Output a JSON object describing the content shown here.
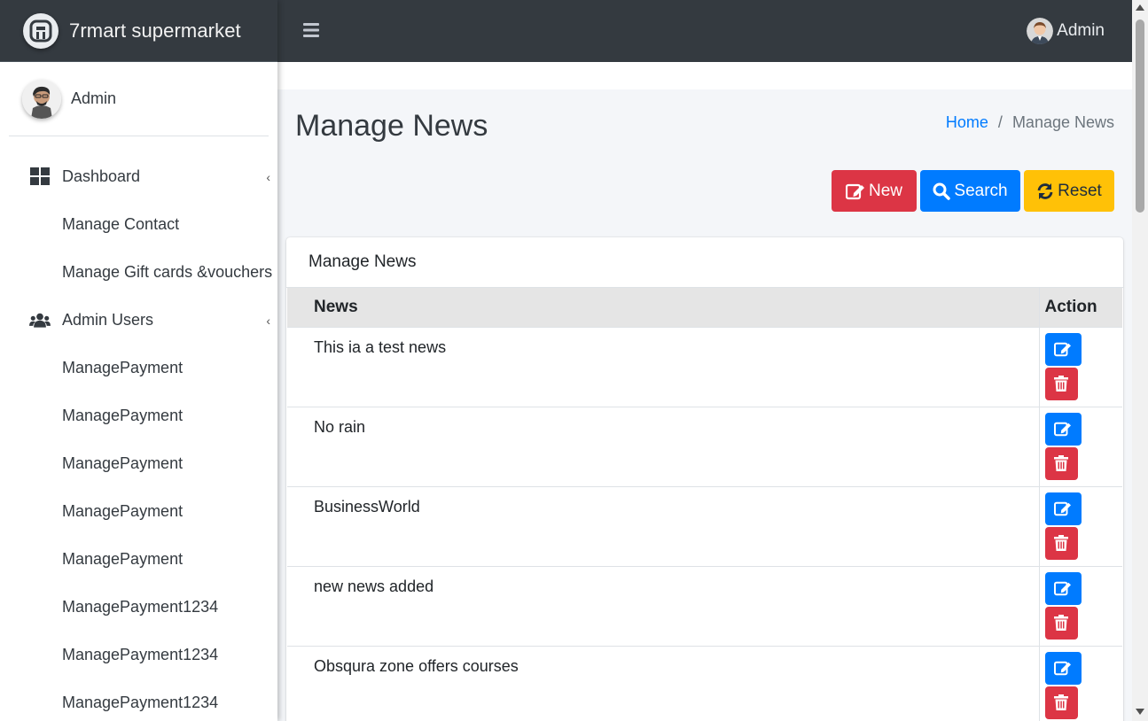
{
  "brand": {
    "name": "7rmart supermarket",
    "logo_icon": "brand-logo-icon"
  },
  "sidebar": {
    "user_name": "Admin",
    "items": [
      {
        "label": "Dashboard",
        "icon": "dashboard-grid-icon",
        "type": "parent"
      },
      {
        "label": "Manage Contact",
        "type": "child"
      },
      {
        "label": "Manage Gift cards &vouchers",
        "type": "child"
      },
      {
        "label": "Admin Users",
        "icon": "users-icon",
        "type": "parent"
      },
      {
        "label": "ManagePayment",
        "type": "child"
      },
      {
        "label": "ManagePayment",
        "type": "child"
      },
      {
        "label": "ManagePayment",
        "type": "child"
      },
      {
        "label": "ManagePayment",
        "type": "child"
      },
      {
        "label": "ManagePayment",
        "type": "child"
      },
      {
        "label": "ManagePayment1234",
        "type": "child"
      },
      {
        "label": "ManagePayment1234",
        "type": "child"
      },
      {
        "label": "ManagePayment1234",
        "type": "child"
      }
    ]
  },
  "topbar": {
    "user_label": "Admin",
    "menu_icon": "hamburger-menu-icon"
  },
  "page": {
    "title": "Manage News",
    "breadcrumb": {
      "home": "Home",
      "separator": "/",
      "current": "Manage News"
    }
  },
  "toolbar": {
    "new_label": "New",
    "search_label": "Search",
    "reset_label": "Reset"
  },
  "card": {
    "title": "Manage News",
    "columns": [
      "News",
      "Action"
    ],
    "rows": [
      {
        "news": "This ia a test news"
      },
      {
        "news": "No rain"
      },
      {
        "news": "BusinessWorld"
      },
      {
        "news": "new news added"
      },
      {
        "news": "Obsqura zone offers courses"
      }
    ]
  },
  "colors": {
    "topbar": "#343a40",
    "primary": "#007bff",
    "danger": "#dc3545",
    "warning": "#ffc107",
    "content_bg": "#f4f6f9"
  }
}
